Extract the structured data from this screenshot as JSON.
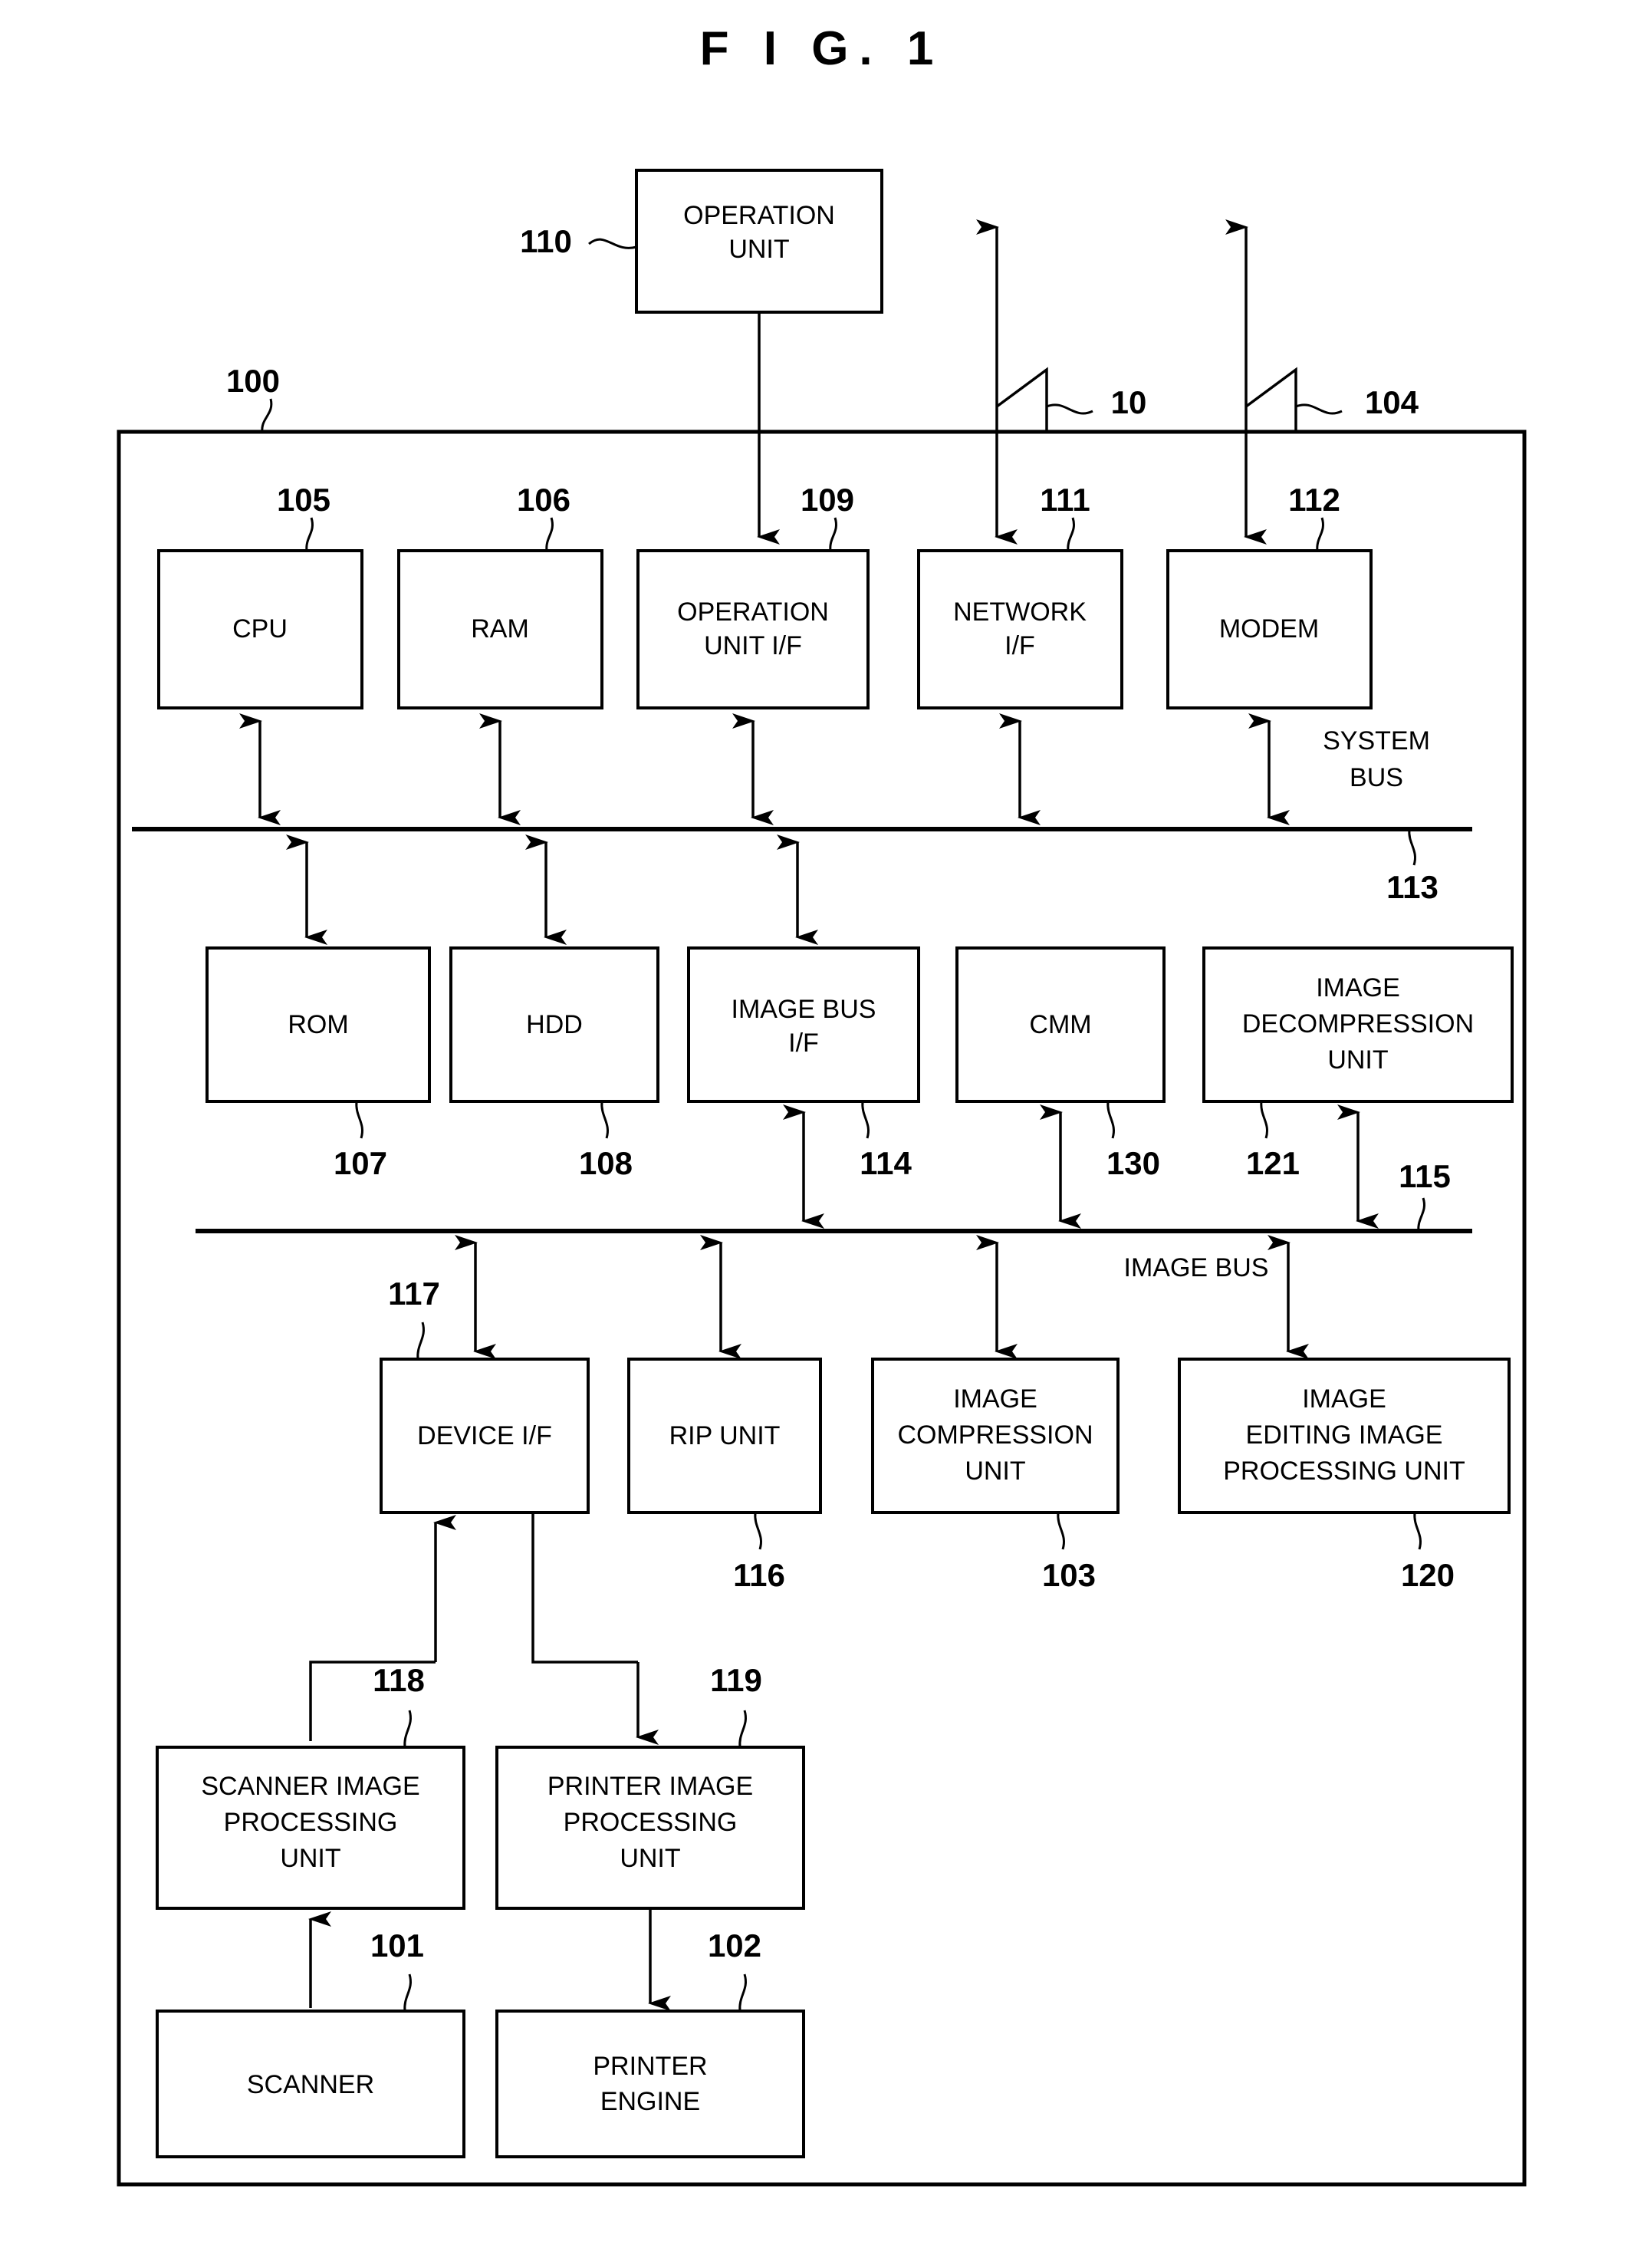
{
  "figure": {
    "title": "F I G. 1",
    "system_ref": "100"
  },
  "buses": [
    {
      "id": "system-bus",
      "label_line1": "SYSTEM",
      "label_line2": "BUS",
      "ref": "113"
    },
    {
      "id": "image-bus",
      "label_line1": "IMAGE BUS",
      "label_line2": "",
      "ref": "115"
    }
  ],
  "external_links": [
    {
      "id": "network-link",
      "ref": "10"
    },
    {
      "id": "modem-link",
      "ref": "104"
    }
  ],
  "blocks": [
    {
      "id": "operation-unit",
      "ref": "110",
      "lines": [
        "OPERATION",
        "UNIT"
      ]
    },
    {
      "id": "cpu",
      "ref": "105",
      "lines": [
        "CPU"
      ]
    },
    {
      "id": "ram",
      "ref": "106",
      "lines": [
        "RAM"
      ]
    },
    {
      "id": "operation-unit-if",
      "ref": "109",
      "lines": [
        "OPERATION",
        "UNIT I/F"
      ]
    },
    {
      "id": "network-if",
      "ref": "111",
      "lines": [
        "NETWORK",
        "I/F"
      ]
    },
    {
      "id": "modem",
      "ref": "112",
      "lines": [
        "MODEM"
      ]
    },
    {
      "id": "rom",
      "ref": "107",
      "lines": [
        "ROM"
      ]
    },
    {
      "id": "hdd",
      "ref": "108",
      "lines": [
        "HDD"
      ]
    },
    {
      "id": "image-bus-if",
      "ref": "114",
      "lines": [
        "IMAGE BUS",
        "I/F"
      ]
    },
    {
      "id": "cmm",
      "ref": "130",
      "lines": [
        "CMM"
      ]
    },
    {
      "id": "image-decompression",
      "ref": "121",
      "lines": [
        "IMAGE",
        "DECOMPRESSION",
        "UNIT"
      ]
    },
    {
      "id": "device-if",
      "ref": "117",
      "lines": [
        "DEVICE I/F"
      ]
    },
    {
      "id": "rip-unit",
      "ref": "116",
      "lines": [
        "RIP UNIT"
      ]
    },
    {
      "id": "image-compression",
      "ref": "103",
      "lines": [
        "IMAGE",
        "COMPRESSION",
        "UNIT"
      ]
    },
    {
      "id": "image-editing",
      "ref": "120",
      "lines": [
        "IMAGE",
        "EDITING IMAGE",
        "PROCESSING UNIT"
      ]
    },
    {
      "id": "scanner-image-proc",
      "ref": "118",
      "lines": [
        "SCANNER IMAGE",
        "PROCESSING",
        "UNIT"
      ]
    },
    {
      "id": "printer-image-proc",
      "ref": "119",
      "lines": [
        "PRINTER IMAGE",
        "PROCESSING",
        "UNIT"
      ]
    },
    {
      "id": "scanner",
      "ref": "101",
      "lines": [
        "SCANNER"
      ]
    },
    {
      "id": "printer-engine",
      "ref": "102",
      "lines": [
        "PRINTER",
        "ENGINE"
      ]
    }
  ],
  "colors": {
    "ink": "#000000",
    "paper": "#ffffff"
  }
}
